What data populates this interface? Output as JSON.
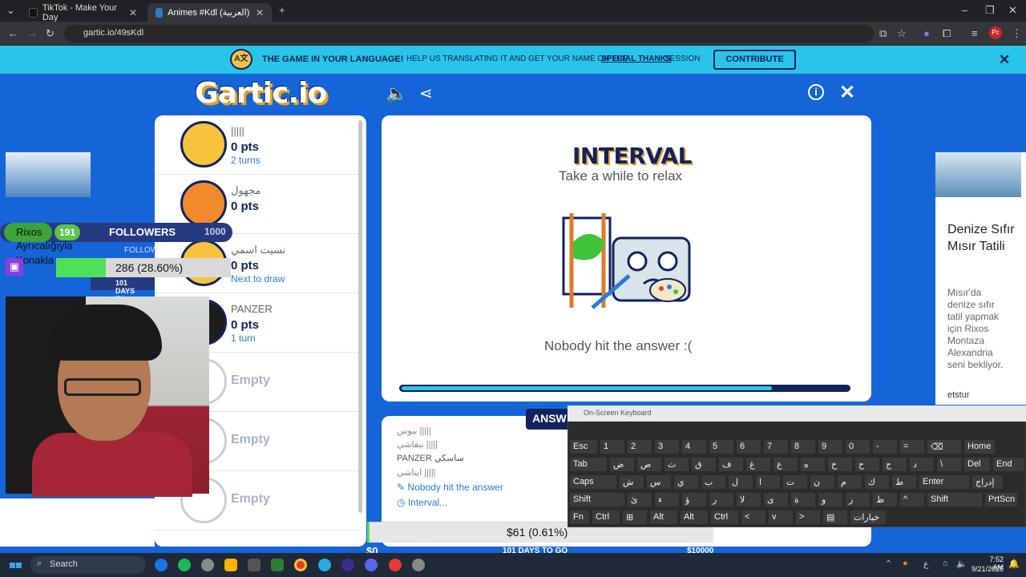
{
  "browser": {
    "tabs": [
      {
        "label": "TikTok - Make Your Day"
      },
      {
        "label": "Animes #Kdl (العربية) - Garti"
      }
    ],
    "url": "gartic.io/49sKdl"
  },
  "banner": {
    "strong": "THE GAME IN YOUR LANGUAGE!",
    "text": "HELP US TRANSLATING IT AND GET YOUR NAME ON THE",
    "link": "SPECIAL THANKS",
    "text2": "SESSION",
    "button": "CONTRIBUTE",
    "icon_text": "A文"
  },
  "header": {
    "logo": "Gartic.io"
  },
  "players": [
    {
      "name": "|||||",
      "pts": "0 pts",
      "turn": "2 turns",
      "avatar": "yellow"
    },
    {
      "name": "مجهول",
      "pts": "0 pts",
      "turn": "",
      "avatar": "orange"
    },
    {
      "name": "نسيت اسمي",
      "pts": "0 pts",
      "turn": "Next to draw",
      "avatar": "yellow"
    },
    {
      "name": "PANZER",
      "pts": "0 pts",
      "turn": "1 turn",
      "avatar": "dark"
    },
    {
      "empty": "Empty"
    },
    {
      "empty": "Empty"
    },
    {
      "empty": "Empty"
    }
  ],
  "canvas": {
    "title": "INTERVAL",
    "subtitle": "Take a while to relax",
    "message": "Nobody hit the answer :(",
    "progress": 0.83
  },
  "answers": {
    "tab": "ANSW",
    "lines": [
      "بيوس |||||",
      "بيقاشي |||||",
      "PANZER ساسكي",
      "ايتاشي |||||"
    ],
    "status1": "Nobody hit the answer",
    "status2": "Interval..."
  },
  "ad_right": {
    "title": "Denize Sıfır Mısır Tatili",
    "body": "Mısır'da denize sıfır tatil yapmak için Rixos Montaza Alexandria seni bekliyor.",
    "brand": "etstur"
  },
  "stream_overlay": {
    "follow_count": "191",
    "followers_label": "FOLLOWERS",
    "follow_goal": "1000",
    "follow_sub": "FOLLOW",
    "rixos": "Rixos",
    "ayr1": "Ayrıcalığıyla",
    "ayr2": "Konakla",
    "sub_text": "286 (28.60%)",
    "sub_progress": 0.286,
    "days_label": "101 DAYS TO"
  },
  "donation": {
    "text": "$61 (0.61%)",
    "progress": 0.0061,
    "start": "$0",
    "days": "101 DAYS TO GO",
    "goal": "$10000"
  },
  "osk": {
    "title": "On-Screen Keyboard",
    "rows": [
      [
        "Esc",
        "1",
        "2",
        "3",
        "4",
        "5",
        "6",
        "7",
        "8",
        "9",
        "0",
        "-",
        "=",
        "⌫",
        "Home"
      ],
      [
        "Tab",
        "ض",
        "ص",
        "ث",
        "ق",
        "ف",
        "غ",
        "ع",
        "ه",
        "خ",
        "ح",
        "ج",
        "د",
        "\\",
        "Del",
        "End"
      ],
      [
        "Caps",
        "ش",
        "س",
        "ي",
        "ب",
        "ل",
        "ا",
        "ت",
        "ن",
        "م",
        "ك",
        "ط",
        "Enter",
        "إدراج"
      ],
      [
        "Shift",
        "ئ",
        "ء",
        "ؤ",
        "ر",
        "لا",
        "ى",
        "ة",
        "و",
        "ز",
        "ظ",
        "^",
        "Shift",
        "PrtScn"
      ],
      [
        "Fn",
        "Ctrl",
        "⊞",
        "Alt",
        "Alt",
        "Ctrl",
        "<",
        "v",
        ">",
        "▤",
        "خيارات"
      ]
    ]
  },
  "taskbar": {
    "search": "Search",
    "time": "7:52 AM",
    "date": "9/21/2025"
  }
}
